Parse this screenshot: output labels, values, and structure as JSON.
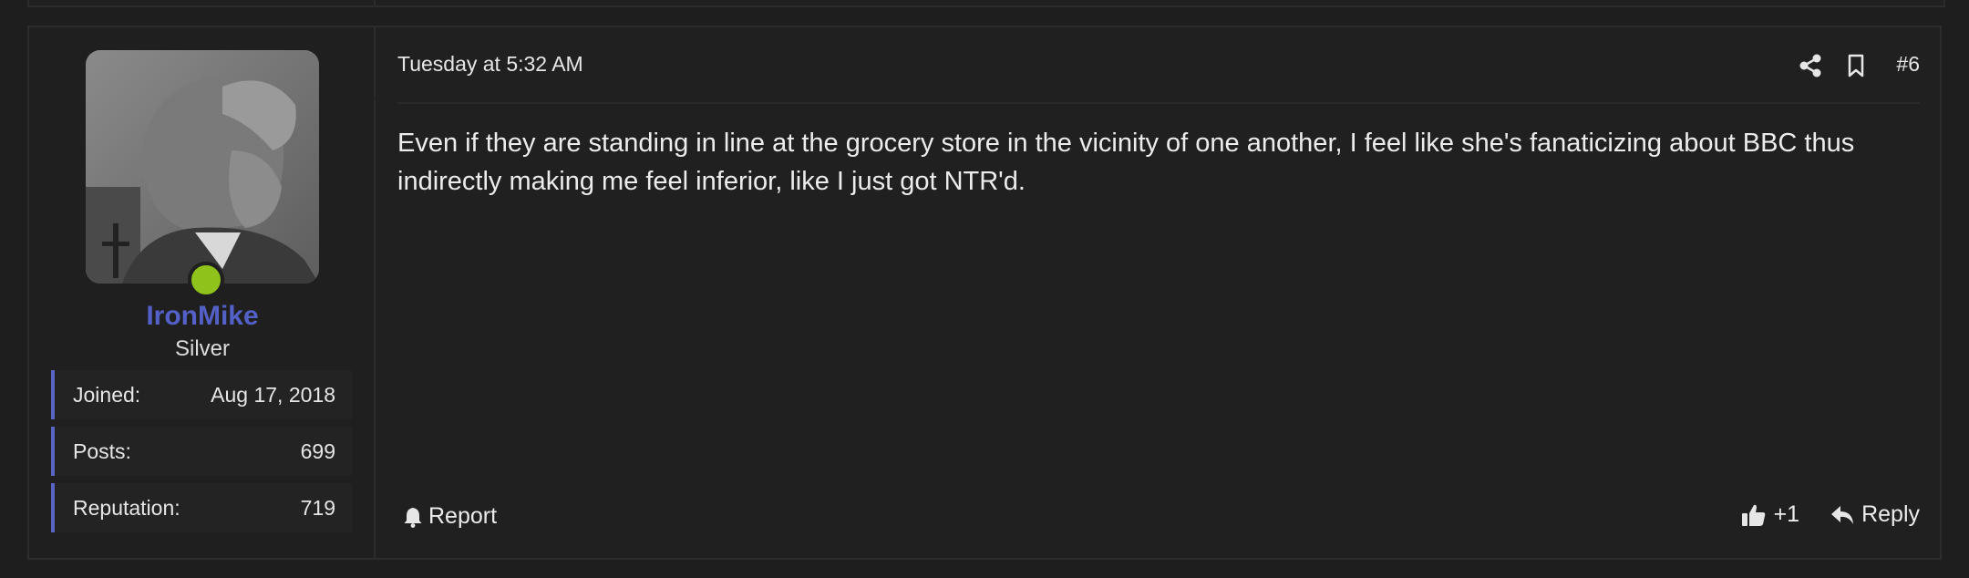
{
  "user": {
    "username": "IronMike",
    "title": "Silver",
    "online": true,
    "stats": [
      {
        "label": "Joined:",
        "value": "Aug 17, 2018"
      },
      {
        "label": "Posts:",
        "value": "699"
      },
      {
        "label": "Reputation:",
        "value": "719"
      }
    ]
  },
  "post": {
    "date": "Tuesday at 5:32 AM",
    "number": "#6",
    "body": "Even if they are standing in line at the grocery store in the vicinity of one another, I feel like she's fanaticizing about BBC thus indirectly making me feel inferior, like I just got NTR'd."
  },
  "actions": {
    "report": "Report",
    "like": "+1",
    "reply": "Reply"
  },
  "icons": {
    "share": "share-icon",
    "bookmark": "bookmark-icon",
    "report": "bell-icon",
    "like": "thumbs-up-icon",
    "reply": "reply-arrow-icon"
  },
  "colors": {
    "username": "#5361c7",
    "online": "#8fc21a",
    "stat_accent": "#5a64c4",
    "background": "#1e1e1e"
  }
}
